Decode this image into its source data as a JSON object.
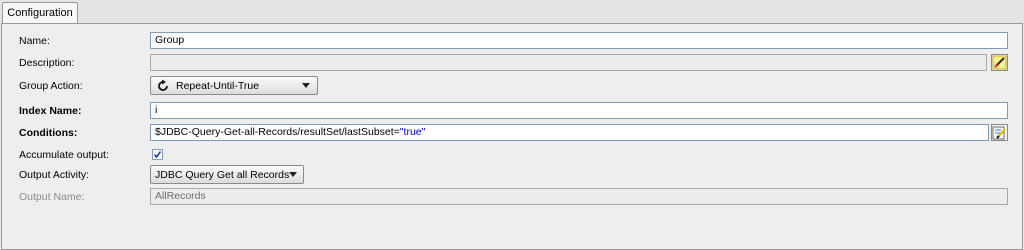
{
  "tabs": [
    {
      "label": "Configuration"
    }
  ],
  "form": {
    "name": {
      "label": "Name:",
      "value": "Group"
    },
    "description": {
      "label": "Description:",
      "value": ""
    },
    "group_action": {
      "label": "Group Action:",
      "value": "Repeat-Until-True",
      "icon": "loop-icon"
    },
    "index_name": {
      "label": "Index Name:",
      "value": "i"
    },
    "conditions": {
      "label": "Conditions:",
      "value_prefix": "$JDBC-Query-Get-all-Records/resultSet/lastSubset=",
      "value_string": "\"true\""
    },
    "accumulate_output": {
      "label": "Accumulate output:",
      "checked": true
    },
    "output_activity": {
      "label": "Output Activity:",
      "value": "JDBC Query Get all Records"
    },
    "output_name": {
      "label": "Output Name:",
      "value": "AllRecords"
    }
  },
  "colors": {
    "expression_string": "#0000c8",
    "field_border": "#7f9db9"
  }
}
